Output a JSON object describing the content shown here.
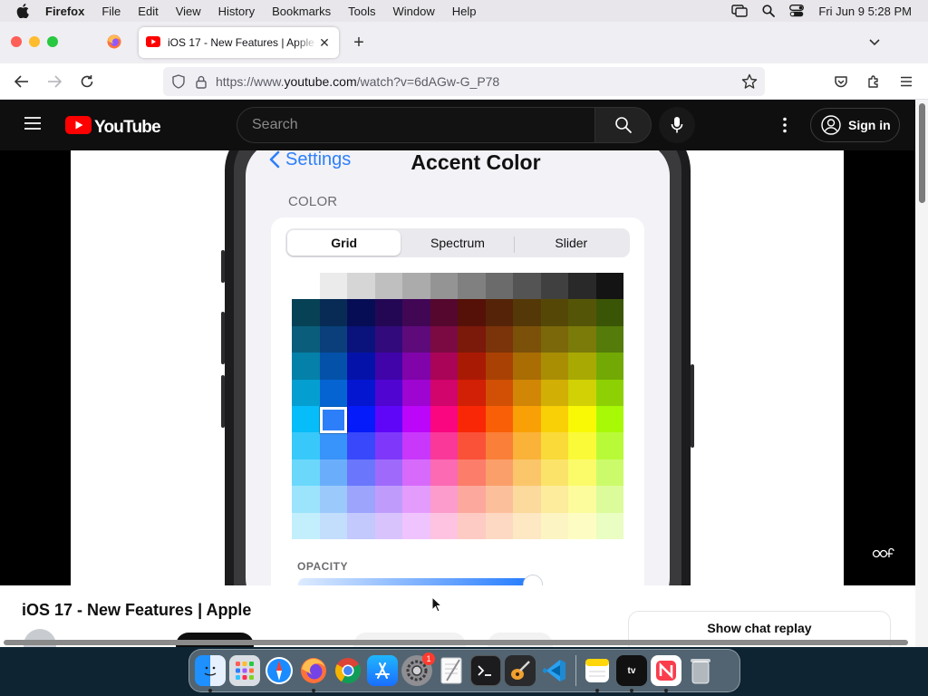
{
  "menubar": {
    "app_name": "Firefox",
    "items": [
      "File",
      "Edit",
      "View",
      "History",
      "Bookmarks",
      "Tools",
      "Window",
      "Help"
    ],
    "clock": "Fri Jun 9  5:28 PM"
  },
  "browser": {
    "active_tab_title": "iOS 17 - New Features | Apple",
    "url_prefix": "https://www.",
    "url_host": "youtube.com",
    "url_path": "/watch?v=6dAGw-G_P78"
  },
  "youtube": {
    "logo_text": "YouTube",
    "search_placeholder": "Search",
    "sign_in_label": "Sign in",
    "video_title": "iOS 17 - New Features | Apple",
    "chat_replay_label": "Show chat replay"
  },
  "phone_screen": {
    "back_label": "Settings",
    "title": "Accent Color",
    "section_label": "COLOR",
    "segments": [
      "Grid",
      "Spectrum",
      "Slider"
    ],
    "active_segment": 0,
    "opacity_label": "OPACITY",
    "opacity_value": 0.93
  },
  "dock": {
    "apps": [
      "Finder",
      "Launchpad",
      "Safari",
      "Firefox",
      "Chrome",
      "App Store",
      "System Settings",
      "TextEdit",
      "Terminal",
      "GarageBand",
      "Visual Studio Code",
      "Notes",
      "Apple TV",
      "News",
      "Trash"
    ],
    "settings_badge": "1",
    "tv_label": "tv"
  },
  "colors": {
    "youtube_red": "#ff0000",
    "ios_blue": "#2d7ff9"
  }
}
